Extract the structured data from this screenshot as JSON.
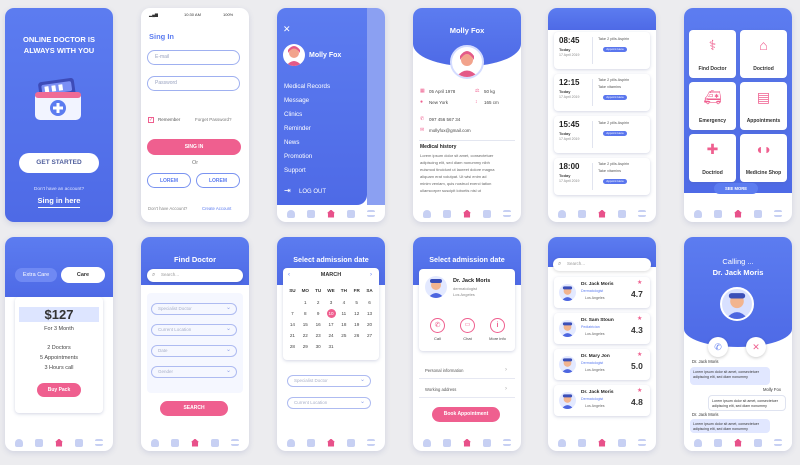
{
  "welcome": {
    "title": "ONLINE DOCTOR IS\nALWAYS WITH YOU",
    "cta": "GET STARTED",
    "no_account": "Don't have an account?",
    "signin": "Sing in here"
  },
  "signin": {
    "status_time": "10:30 AM",
    "battery": "100%",
    "title": "Sing In",
    "email": "E-mail",
    "password": "Password",
    "remember": "Remember",
    "forgot": "Forget Password?",
    "button": "SING IN",
    "or": "Or",
    "lorem1": "LOREM",
    "lorem2": "LOREM",
    "no_account": "Don't have Account?",
    "create": "Create Account"
  },
  "menu": {
    "name": "Molly Fox",
    "items": [
      "Medical Records",
      "Message",
      "Clinics",
      "Reminder",
      "News",
      "Promotion",
      "Support"
    ],
    "logout": "LOG OUT"
  },
  "profile": {
    "name": "Molly Fox",
    "dob": "05 April 1978",
    "city": "New York",
    "weight": "50 kg",
    "height": "165 cm",
    "phone": "097 456 567 34",
    "email": "mollyfox@gmail.com",
    "history_title": "Medical history",
    "history_text": [
      "Lorem ipsum dolor sit amet, consectetuer",
      "adipiscing elit, sed diam nonummy nibh",
      "euismod tincidunt ut laoreet dolore magna",
      "aliquam erat volutpat. Ut wisi enim ad",
      "minim veniam, quis nostrud exerci tation",
      "ullamcorper suscipit lobortis nisl ut"
    ]
  },
  "reminders": [
    {
      "time": "08:45",
      "day": "Today",
      "date": "17 April 2019",
      "l1": "Take 2 pills Aspirin",
      "l2": "",
      "pill": "Appoint Here"
    },
    {
      "time": "12:15",
      "day": "Today",
      "date": "17 April 2019",
      "l1": "Take 2 pills Aspirin",
      "l2": "Take vitamins",
      "pill": "Appoint Here"
    },
    {
      "time": "15:45",
      "day": "Today",
      "date": "17 April 2019",
      "l1": "Take 2 pills Aspirin",
      "l2": "",
      "pill": "Appoint Here"
    },
    {
      "time": "18:00",
      "day": "Today",
      "date": "17 April 2019",
      "l1": "Take 2 pills Aspirin",
      "l2": "Take vitamins",
      "pill": "Appoint Here"
    }
  ],
  "categories": {
    "items": [
      "Find Doctor",
      "Doctriod",
      "Emergency",
      "Appointments",
      "Doctriod",
      "Medicine Shop"
    ],
    "more": "SEE MORE"
  },
  "pricing": {
    "tab1": "Extra Care",
    "tab2": "Care",
    "price": "$127",
    "period": "For 3 Month",
    "f1": "2 Doctors",
    "f2": "5 Appointments",
    "f3": "3 Hours call",
    "button": "Buy Pack"
  },
  "find": {
    "title": "Find Doctor",
    "search": "Search...",
    "fields": [
      "Specialist Doctor",
      "Current Location",
      "Date",
      "Gender"
    ],
    "button": "SEARCH"
  },
  "calendar": {
    "title": "Select admission date",
    "month": "MARCH",
    "days": [
      "SU",
      "MO",
      "TU",
      "WE",
      "TH",
      "FR",
      "SA"
    ],
    "dates": [
      "",
      "1",
      "2",
      "3",
      "4",
      "5",
      "6",
      "7",
      "8",
      "9",
      "10",
      "11",
      "12",
      "13",
      "14",
      "15",
      "16",
      "17",
      "18",
      "19",
      "20",
      "21",
      "22",
      "23",
      "24",
      "25",
      "26",
      "27",
      "28",
      "29",
      "30",
      "31"
    ],
    "selected": "10",
    "field1": "Specialist Doctor",
    "field2": "Current Location"
  },
  "admission": {
    "title": "Select admission date",
    "doctor": "Dr. Jack Moris",
    "spec": "dermatologist",
    "city": "Los Angeles",
    "a1": "Call",
    "a2": "Chat",
    "a3": "More info",
    "row1": "Personal information",
    "row2": "Working address",
    "button": "Book Appointment"
  },
  "doctors": {
    "search": "Search...",
    "list": [
      {
        "name": "Dr. Jack Moris",
        "spec": "Dermatologist",
        "city": "Los Angeles",
        "rating": "4.7"
      },
      {
        "name": "Dr. Sam Stoun",
        "spec": "Pediatrician",
        "city": "Los Angeles",
        "rating": "4.3"
      },
      {
        "name": "Dr. Mary Jon",
        "spec": "Dermatologist",
        "city": "Los Angeles",
        "rating": "5.0"
      },
      {
        "name": "Dr. Jack Moris",
        "spec": "Dermatologist",
        "city": "Los Angeles",
        "rating": "4.8"
      }
    ]
  },
  "call": {
    "calling": "Calling ...",
    "name": "Dr. Jack Moris",
    "chat": [
      {
        "who": "Dr. Jack Moris",
        "text": "Lorem ipsum dolor sit amet, consectetuer adipiscing elit, sed diam nonummy"
      },
      {
        "who": "Molly Fox",
        "text": "Lorem ipsum dolor sit amet, consectetuer adipiscing elit, sed diam nonummy"
      },
      {
        "who": "Dr. Jack Moris",
        "text": "Lorem ipsum dolor sit amet, consectetuer adipiscing elit, sed diam nonummy"
      }
    ]
  },
  "colors": {
    "primary": "#5c7cf0",
    "accent": "#ef5f8f",
    "background": "#ececef"
  }
}
